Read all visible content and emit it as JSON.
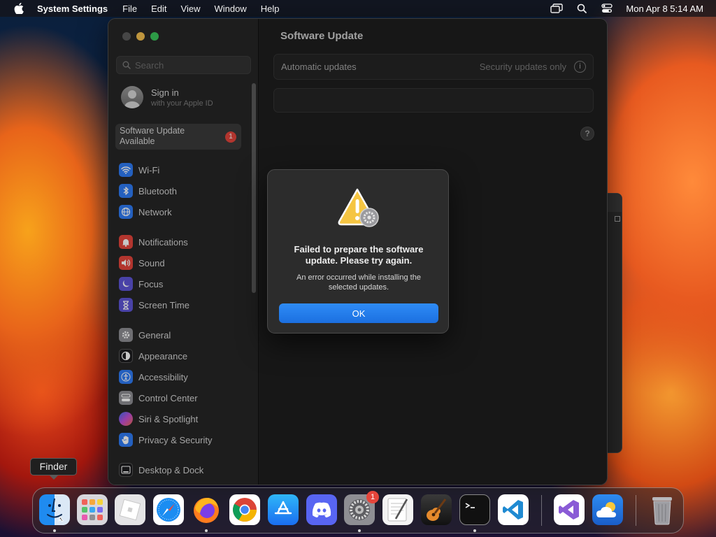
{
  "menubar": {
    "app_name": "System Settings",
    "menus": [
      "File",
      "Edit",
      "View",
      "Window",
      "Help"
    ],
    "clock": "Mon Apr 8  5:14 AM"
  },
  "sidebar": {
    "search_placeholder": "Search",
    "signin_title": "Sign in",
    "signin_subtitle": "with your Apple ID",
    "update_label": "Software Update Available",
    "update_badge": "1",
    "items": [
      {
        "label": "Wi-Fi",
        "icon": "wifi-icon",
        "color": "#2f7bf5"
      },
      {
        "label": "Bluetooth",
        "icon": "bluetooth-icon",
        "color": "#2f7bf5"
      },
      {
        "label": "Network",
        "icon": "globe-icon",
        "color": "#2f7bf5"
      },
      {
        "label": "Notifications",
        "icon": "bell-icon",
        "color": "#e5453b"
      },
      {
        "label": "Sound",
        "icon": "speaker-icon",
        "color": "#e5453b"
      },
      {
        "label": "Focus",
        "icon": "moon-icon",
        "color": "#5e55d6"
      },
      {
        "label": "Screen Time",
        "icon": "hourglass-icon",
        "color": "#5e55d6"
      },
      {
        "label": "General",
        "icon": "gear-icon",
        "color": "#8e8e93"
      },
      {
        "label": "Appearance",
        "icon": "appearance-icon",
        "color": "#1c1c1e"
      },
      {
        "label": "Accessibility",
        "icon": "accessibility-icon",
        "color": "#2f7bf5"
      },
      {
        "label": "Control Center",
        "icon": "control-center-icon",
        "color": "#8e8e93"
      },
      {
        "label": "Siri & Spotlight",
        "icon": "siri-icon",
        "color": "#b04fd8"
      },
      {
        "label": "Privacy & Security",
        "icon": "hand-icon",
        "color": "#2f7bf5"
      },
      {
        "label": "Desktop & Dock",
        "icon": "dock-icon",
        "color": "#1c1c1e"
      }
    ]
  },
  "content": {
    "title": "Software Update",
    "auto_label": "Automatic updates",
    "auto_value": "Security updates only",
    "info": "i",
    "help": "?"
  },
  "alert": {
    "title": "Failed to prepare the software update. Please try again.",
    "message": "An error occurred while installing the selected updates.",
    "ok": "OK"
  },
  "tooltip": "Finder",
  "dock": {
    "settings_badge": "1",
    "apps": [
      "Finder",
      "Launchpad",
      "Roblox",
      "Safari",
      "Firefox",
      "Chrome",
      "App Store",
      "Discord",
      "System Settings",
      "TextEdit",
      "GarageBand",
      "Terminal",
      "Visual Studio Code",
      "Visual Studio",
      "Weather",
      "Trash"
    ]
  }
}
